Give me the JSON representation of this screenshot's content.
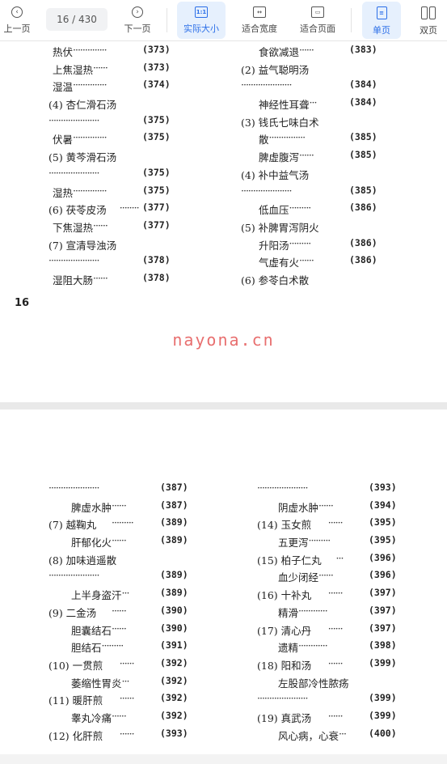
{
  "toolbar": {
    "prev": "上一页",
    "page_counter": "16 / 430",
    "next": "下一页",
    "actual_size": "实际大小",
    "actual_size_icon": "1:1",
    "fit_width": "适合宽度",
    "fit_page": "适合页面",
    "single_page": "单页",
    "double_page": "双页",
    "accent": "#2c6fe8"
  },
  "page1": {
    "left": [
      {
        "title": "热伏",
        "dots": "··············",
        "page": "(373)"
      },
      {
        "title": "上焦湿热",
        "dots": "······",
        "page": "(373)"
      },
      {
        "title": "湿温",
        "dots": "··············",
        "page": "(374)"
      },
      {
        "title": "(4)  杏仁滑石汤",
        "dots": "",
        "page": ""
      },
      {
        "title": "",
        "dots": "·····················",
        "page": "(375)"
      },
      {
        "title": "伏暑",
        "dots": "··············",
        "page": "(375)"
      },
      {
        "title": "(5)  黄芩滑石汤",
        "dots": "",
        "page": ""
      },
      {
        "title": "",
        "dots": "·····················",
        "page": "(375)"
      },
      {
        "title": "湿热",
        "dots": "··············",
        "page": "(375)"
      },
      {
        "title": "(6)  茯苓皮汤",
        "dots": "········",
        "page": "(377)"
      },
      {
        "title": "下焦湿热",
        "dots": "······",
        "page": "(377)"
      },
      {
        "title": "(7)  宣清导浊汤",
        "dots": "",
        "page": ""
      },
      {
        "title": "",
        "dots": "·····················",
        "page": "(378)"
      },
      {
        "title": "湿阻大肠",
        "dots": "······",
        "page": "(378)"
      }
    ],
    "right": [
      {
        "title": "食欲减退",
        "dots": "······",
        "page": "(383)"
      },
      {
        "title": "(2)  益气聪明汤",
        "dots": "",
        "page": ""
      },
      {
        "title": "",
        "dots": "·····················",
        "page": "(384)"
      },
      {
        "title": "神经性耳聋",
        "dots": "···",
        "page": "(384)"
      },
      {
        "title": "(3)  钱氏七味白术",
        "dots": "",
        "page": ""
      },
      {
        "title": "散",
        "dots": "···············",
        "page": "(385)"
      },
      {
        "title": "脾虚腹泻",
        "dots": "······",
        "page": "(385)"
      },
      {
        "title": "(4)  补中益气汤",
        "dots": "",
        "page": ""
      },
      {
        "title": "",
        "dots": "·····················",
        "page": "(385)"
      },
      {
        "title": "低血压",
        "dots": "·········",
        "page": "(386)"
      },
      {
        "title": "(5)  补脾胃泻阴火",
        "dots": "",
        "page": ""
      },
      {
        "title": "升阳汤",
        "dots": "·········",
        "page": "(386)"
      },
      {
        "title": "气虚有火",
        "dots": "······",
        "page": "(386)"
      },
      {
        "title": "(6)  参苓白术散",
        "dots": "",
        "page": ""
      }
    ],
    "page_number": "16"
  },
  "watermark": "nayona.cn",
  "page2": {
    "left": [
      {
        "title": "",
        "dots": "·····················",
        "page": "(387)"
      },
      {
        "title": "脾虚水肿",
        "dots": "······",
        "page": "(387)"
      },
      {
        "title": "(7)  越鞠丸",
        "dots": "·········",
        "page": "(389)"
      },
      {
        "title": "肝郁化火",
        "dots": "······",
        "page": "(389)"
      },
      {
        "title": "(8)  加味逍遥散",
        "dots": "",
        "page": ""
      },
      {
        "title": "",
        "dots": "·····················",
        "page": "(389)"
      },
      {
        "title": "上半身盗汗",
        "dots": "···",
        "page": "(389)"
      },
      {
        "title": "(9)  二金汤",
        "dots": "······",
        "page": "(390)"
      },
      {
        "title": "胆囊结石",
        "dots": "······",
        "page": "(390)"
      },
      {
        "title": "胆结石",
        "dots": "·········",
        "page": "(391)"
      },
      {
        "title": "(10)  一贯煎",
        "dots": "······",
        "page": "(392)"
      },
      {
        "title": "萎缩性胃炎",
        "dots": "···",
        "page": "(392)"
      },
      {
        "title": "(11)  暖肝煎",
        "dots": "······",
        "page": "(392)"
      },
      {
        "title": "睾丸冷痛",
        "dots": "······",
        "page": "(392)"
      },
      {
        "title": "(12)  化肝煎",
        "dots": "······",
        "page": "(393)"
      }
    ],
    "right": [
      {
        "title": "",
        "dots": "·····················",
        "page": "(393)"
      },
      {
        "title": "阴虚水肿",
        "dots": "······",
        "page": "(394)"
      },
      {
        "title": "(14)  玉女煎",
        "dots": "······",
        "page": "(395)"
      },
      {
        "title": "五更泻",
        "dots": "·········",
        "page": "(395)"
      },
      {
        "title": "(15)  柏子仁丸",
        "dots": "···",
        "page": "(396)"
      },
      {
        "title": "血少闭经",
        "dots": "······",
        "page": "(396)"
      },
      {
        "title": "(16)  十补丸",
        "dots": "······",
        "page": "(397)"
      },
      {
        "title": "精滑",
        "dots": "············",
        "page": "(397)"
      },
      {
        "title": "(17)  清心丹",
        "dots": "······",
        "page": "(397)"
      },
      {
        "title": "遗精",
        "dots": "············",
        "page": "(398)"
      },
      {
        "title": "(18)  阳和汤",
        "dots": "······",
        "page": "(399)"
      },
      {
        "title": "左股部冷性脓疡",
        "dots": "",
        "page": ""
      },
      {
        "title": "",
        "dots": "·····················",
        "page": "(399)"
      },
      {
        "title": "(19)  真武汤",
        "dots": "······",
        "page": "(399)"
      },
      {
        "title": "风心病，心衰",
        "dots": "···",
        "page": "(400)"
      }
    ]
  }
}
